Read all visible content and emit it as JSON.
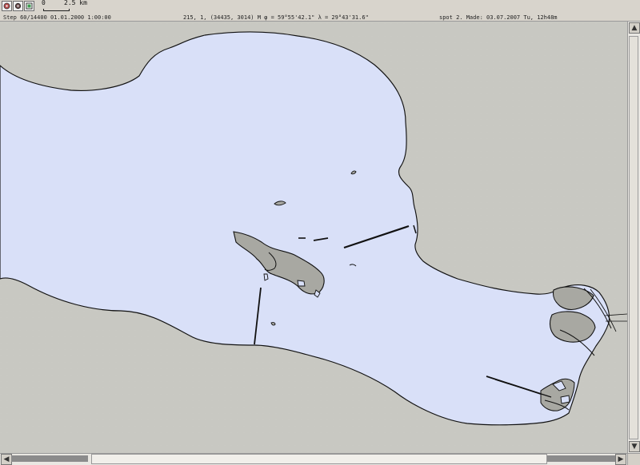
{
  "toolbar": {
    "buttons": [
      {
        "name": "zoom-in-icon",
        "title": "zoom"
      },
      {
        "name": "view-mode-icon",
        "title": "view"
      },
      {
        "name": "frame-icon",
        "title": "frame"
      }
    ],
    "scale_start": "0",
    "scale_label": "2.5 km",
    "step_text": "Step 60/14400  01.01.2000 1:00:00",
    "coords_text": "215, 1,  (34435, 3014) M  φ = 59°55'42.1\"  λ = 29°43'31.6\"",
    "made_text": "spot 2. Made: 03.07.2007 Tu, 12h48m"
  },
  "map": {
    "land_color": "#c8c8c2",
    "water_color": "#d9e0f8",
    "outline_color": "#111111",
    "feature_fill": "#a8a8a2"
  },
  "icons": {
    "up": "up-arrow-icon",
    "down": "down-arrow-icon",
    "left": "left-arrow-icon",
    "right": "right-arrow-icon"
  }
}
